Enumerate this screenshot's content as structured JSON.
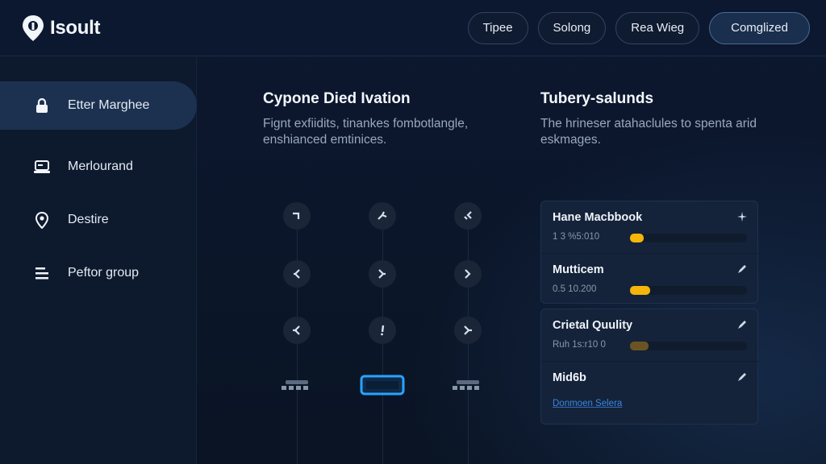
{
  "header": {
    "brand": "Isoult",
    "nav": [
      {
        "label": "Tipee",
        "active": false
      },
      {
        "label": "Solong",
        "active": false
      },
      {
        "label": "Rea Wieg",
        "active": false
      },
      {
        "label": "Comglized",
        "active": true
      }
    ]
  },
  "sidebar": {
    "items": [
      {
        "label": "Etter Marghee",
        "icon": "lock-icon",
        "active": true
      },
      {
        "label": "Merlourand",
        "icon": "laptop-icon",
        "active": false
      },
      {
        "label": "Destire",
        "icon": "location-pin-icon",
        "active": false
      },
      {
        "label": "Peftor group",
        "icon": "list-icon",
        "active": false
      }
    ]
  },
  "left_panel": {
    "title": "Cypone Died Ivation",
    "description": "Fignt exfiidits, tinankes fombotlangle, enshianced emtinices."
  },
  "right_panel": {
    "title": "Tubery-salunds",
    "description": "The hrineser atahaclules to spenta arid eskmages."
  },
  "list": {
    "groups": [
      {
        "rows": [
          {
            "title": "Hane Macbbook",
            "meta": "1 3 %5:010",
            "progress": 0.12,
            "bar_color": "#f5b50a",
            "action_icon": "sparkle-icon"
          },
          {
            "title": "Mutticem",
            "meta": "0.5 10.200",
            "progress": 0.17,
            "bar_color": "#f5b50a",
            "action_icon": "pencil-icon"
          }
        ]
      },
      {
        "rows": [
          {
            "title": "Crietal Quulity",
            "meta": "Ruh 1s:r10 0",
            "progress": 0.16,
            "bar_color": "#6b5424",
            "action_icon": "pencil-icon"
          },
          {
            "title": "Mid6b",
            "meta": "Donmoen Selera",
            "meta_is_link": true,
            "action_icon": "pencil-icon"
          }
        ]
      }
    ]
  },
  "colors": {
    "accent": "#3a86e0",
    "warning": "#f5b50a",
    "highlight_widget": "#29a3ff"
  }
}
